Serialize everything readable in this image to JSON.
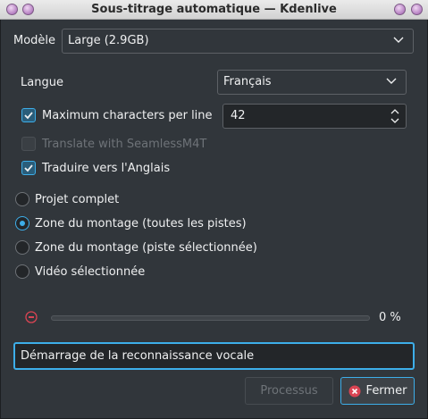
{
  "window": {
    "title": "Sous-titrage automatique — Kdenlive"
  },
  "model": {
    "label": "Modèle",
    "value": "Large (2.9GB)"
  },
  "language": {
    "label": "Langue",
    "value": "Français"
  },
  "max_chars": {
    "label": "Maximum characters per line",
    "checked": true,
    "value": "42"
  },
  "translate_seamless": {
    "label": "Translate with SeamlessM4T",
    "checked": false,
    "enabled": false
  },
  "translate_english": {
    "label": "Traduire vers l'Anglais",
    "checked": true
  },
  "scope": {
    "options": [
      {
        "label": "Projet complet",
        "selected": false
      },
      {
        "label": "Zone du montage (toutes les pistes)",
        "selected": true
      },
      {
        "label": "Zone du montage (piste sélectionnée)",
        "selected": false
      },
      {
        "label": "Vidéo sélectionnée",
        "selected": false
      }
    ]
  },
  "progress": {
    "value": 0,
    "text": "0 %"
  },
  "status": {
    "value": "Démarrage de la reconnaissance vocale"
  },
  "buttons": {
    "process_label": "Processus",
    "close_label": "Fermer"
  },
  "colors": {
    "background": "#31363b",
    "accent": "#3daee9",
    "stop_icon": "#da4453",
    "titlebar_button": "#b57fc1"
  }
}
